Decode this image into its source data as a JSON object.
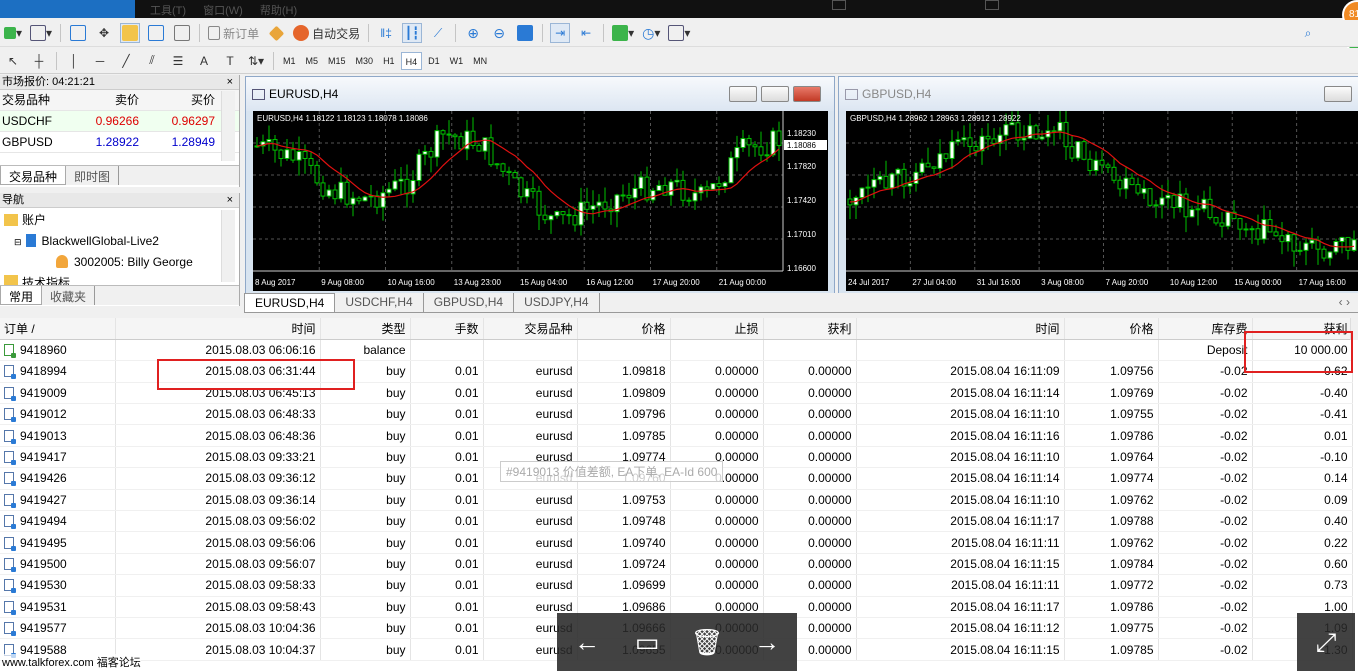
{
  "app": {
    "menu": [
      "工具(T)",
      "窗口(W)",
      "帮助(H)"
    ],
    "badge_count": "81"
  },
  "toolbar": {
    "new_order": "新订单",
    "auto_trading": "自动交易",
    "timeframes": [
      "M1",
      "M5",
      "M15",
      "M30",
      "H1",
      "H4",
      "D1",
      "W1",
      "MN"
    ],
    "active_timeframe": "H4"
  },
  "market_watch": {
    "title": "市场报价: 04:21:21",
    "headers": [
      "交易品种",
      "卖价",
      "买价"
    ],
    "rows": [
      {
        "symbol": "USDCHF",
        "bid": "0.96266",
        "ask": "0.96297"
      },
      {
        "symbol": "GBPUSD",
        "bid": "1.28922",
        "ask": "1.28949"
      }
    ],
    "tabs": [
      "交易品种",
      "即时图"
    ]
  },
  "navigator": {
    "title": "导航",
    "items": [
      "账户",
      "BlackwellGlobal-Live2",
      "3002005: Billy  George",
      "技术指标"
    ],
    "tabs": [
      "常用",
      "收藏夹"
    ]
  },
  "charts": [
    {
      "window_title": "EURUSD,H4",
      "info": "EURUSD,H4  1.18122 1.18123 1.18078 1.18086",
      "price_labels": [
        "1.18230",
        "1.18086",
        "1.17820",
        "1.17420",
        "1.17010",
        "1.16600"
      ],
      "time_labels": [
        "8 Aug 2017",
        "9 Aug 08:00",
        "10 Aug 16:00",
        "13 Aug 23:00",
        "15 Aug 04:00",
        "16 Aug 12:00",
        "17 Aug 20:00",
        "21 Aug 00:00"
      ]
    },
    {
      "window_title": "GBPUSD,H4",
      "info": "GBPUSD,H4  1.28962 1.28963 1.28912 1.28922",
      "time_labels": [
        "24 Jul 2017",
        "27 Jul 04:00",
        "31 Jul 16:00",
        "3 Aug 08:00",
        "7 Aug 20:00",
        "10 Aug 12:00",
        "15 Aug 00:00",
        "17 Aug 16:00"
      ]
    }
  ],
  "chart_tabs": [
    "EURUSD,H4",
    "USDCHF,H4",
    "GBPUSD,H4",
    "USDJPY,H4"
  ],
  "history": {
    "headers": [
      "订单 /",
      "时间",
      "类型",
      "手数",
      "交易品种",
      "价格",
      "止损",
      "获利",
      "时间",
      "价格",
      "库存费",
      "获利"
    ],
    "rows": [
      [
        "9418960",
        "2015.08.03 06:06:16",
        "balance",
        "",
        "",
        "",
        "",
        "",
        "",
        "",
        "Deposit",
        "10 000.00"
      ],
      [
        "9418994",
        "2015.08.03 06:31:44",
        "buy",
        "0.01",
        "eurusd",
        "1.09818",
        "0.00000",
        "0.00000",
        "2015.08.04 16:11:09",
        "1.09756",
        "-0.02",
        "-0.62"
      ],
      [
        "9419009",
        "2015.08.03 06:45:13",
        "buy",
        "0.01",
        "eurusd",
        "1.09809",
        "0.00000",
        "0.00000",
        "2015.08.04 16:11:14",
        "1.09769",
        "-0.02",
        "-0.40"
      ],
      [
        "9419012",
        "2015.08.03 06:48:33",
        "buy",
        "0.01",
        "eurusd",
        "1.09796",
        "0.00000",
        "0.00000",
        "2015.08.04 16:11:10",
        "1.09755",
        "-0.02",
        "-0.41"
      ],
      [
        "9419013",
        "2015.08.03 06:48:36",
        "buy",
        "0.01",
        "eurusd",
        "1.09785",
        "0.00000",
        "0.00000",
        "2015.08.04 16:11:16",
        "1.09786",
        "-0.02",
        "0.01"
      ],
      [
        "9419417",
        "2015.08.03 09:33:21",
        "buy",
        "0.01",
        "eurusd",
        "1.09774",
        "0.00000",
        "0.00000",
        "2015.08.04 16:11:10",
        "1.09764",
        "-0.02",
        "-0.10"
      ],
      [
        "9419426",
        "2015.08.03 09:36:12",
        "buy",
        "0.01",
        "eurusd",
        "1.09760",
        "0.00000",
        "0.00000",
        "2015.08.04 16:11:14",
        "1.09774",
        "-0.02",
        "0.14"
      ],
      [
        "9419427",
        "2015.08.03 09:36:14",
        "buy",
        "0.01",
        "eurusd",
        "1.09753",
        "0.00000",
        "0.00000",
        "2015.08.04 16:11:10",
        "1.09762",
        "-0.02",
        "0.09"
      ],
      [
        "9419494",
        "2015.08.03 09:56:02",
        "buy",
        "0.01",
        "eurusd",
        "1.09748",
        "0.00000",
        "0.00000",
        "2015.08.04 16:11:17",
        "1.09788",
        "-0.02",
        "0.40"
      ],
      [
        "9419495",
        "2015.08.03 09:56:06",
        "buy",
        "0.01",
        "eurusd",
        "1.09740",
        "0.00000",
        "0.00000",
        "2015.08.04 16:11:11",
        "1.09762",
        "-0.02",
        "0.22"
      ],
      [
        "9419500",
        "2015.08.03 09:56:07",
        "buy",
        "0.01",
        "eurusd",
        "1.09724",
        "0.00000",
        "0.00000",
        "2015.08.04 16:11:15",
        "1.09784",
        "-0.02",
        "0.60"
      ],
      [
        "9419530",
        "2015.08.03 09:58:33",
        "buy",
        "0.01",
        "eurusd",
        "1.09699",
        "0.00000",
        "0.00000",
        "2015.08.04 16:11:11",
        "1.09772",
        "-0.02",
        "0.73"
      ],
      [
        "9419531",
        "2015.08.03 09:58:43",
        "buy",
        "0.01",
        "eurusd",
        "1.09686",
        "0.00000",
        "0.00000",
        "2015.08.04 16:11:17",
        "1.09786",
        "-0.02",
        "1.00"
      ],
      [
        "9419577",
        "2015.08.03 10:04:36",
        "buy",
        "0.01",
        "eurusd",
        "1.09666",
        "0.00000",
        "0.00000",
        "2015.08.04 16:11:12",
        "1.09775",
        "-0.02",
        "1.09"
      ],
      [
        "9419588",
        "2015.08.03 10:04:37",
        "buy",
        "0.01",
        "eurusd",
        "1.09655",
        "0.00000",
        "0.00000",
        "2015.08.04 16:11:15",
        "1.09785",
        "-0.02",
        "1.30"
      ]
    ]
  },
  "tooltip": "#9419013  价值差额, EA下单, EA-Id 600",
  "watermark": "www.talkforex.com 福客论坛"
}
